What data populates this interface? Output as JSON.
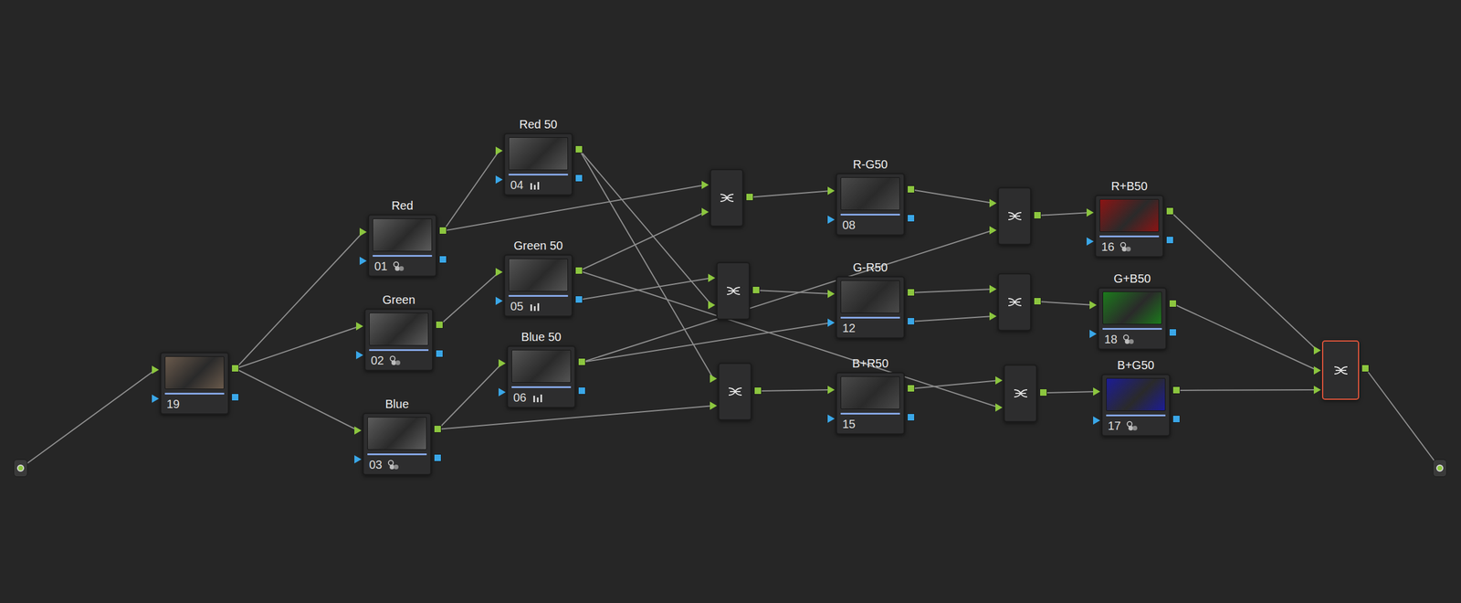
{
  "graph": {
    "nodes": [
      {
        "label": "",
        "number": "19",
        "kind": "plain",
        "color": "#6a5a4c",
        "selected": false
      },
      {
        "label": "Red",
        "number": "01",
        "kind": "rgb-mixer",
        "color": "#5c5c5c",
        "selected": false
      },
      {
        "label": "Green",
        "number": "02",
        "kind": "rgb-mixer",
        "color": "#5c5c5c",
        "selected": false
      },
      {
        "label": "Blue",
        "number": "03",
        "kind": "rgb-mixer",
        "color": "#5c5c5c",
        "selected": false
      },
      {
        "label": "Red 50",
        "number": "04",
        "kind": "levels",
        "color": "#555555",
        "selected": false
      },
      {
        "label": "Green 50",
        "number": "05",
        "kind": "levels",
        "color": "#555555",
        "selected": false
      },
      {
        "label": "Blue 50",
        "number": "06",
        "kind": "levels",
        "color": "#555555",
        "selected": false
      },
      {
        "kind": "layer-mixer",
        "selected": false
      },
      {
        "kind": "layer-mixer",
        "selected": false
      },
      {
        "kind": "layer-mixer",
        "selected": false
      },
      {
        "label": "R-G50",
        "number": "08",
        "kind": "plain",
        "color": "#4a4a4a",
        "selected": false
      },
      {
        "label": "G-R50",
        "number": "12",
        "kind": "plain",
        "color": "#4a4a4a",
        "selected": false
      },
      {
        "label": "B+R50",
        "number": "15",
        "kind": "plain",
        "color": "#4a4a4a",
        "selected": false
      },
      {
        "kind": "layer-mixer",
        "selected": false
      },
      {
        "kind": "layer-mixer",
        "selected": false
      },
      {
        "kind": "layer-mixer",
        "selected": false
      },
      {
        "label": "R+B50",
        "number": "16",
        "kind": "rgb-mixer",
        "color": "#8c1414",
        "selected": false
      },
      {
        "label": "G+B50",
        "number": "18",
        "kind": "rgb-mixer",
        "color": "#1c7a1c",
        "selected": false
      },
      {
        "label": "B+G50",
        "number": "17",
        "kind": "rgb-mixer",
        "color": "#1c1c96",
        "selected": false
      },
      {
        "kind": "layer-mixer",
        "selected": true
      }
    ]
  }
}
